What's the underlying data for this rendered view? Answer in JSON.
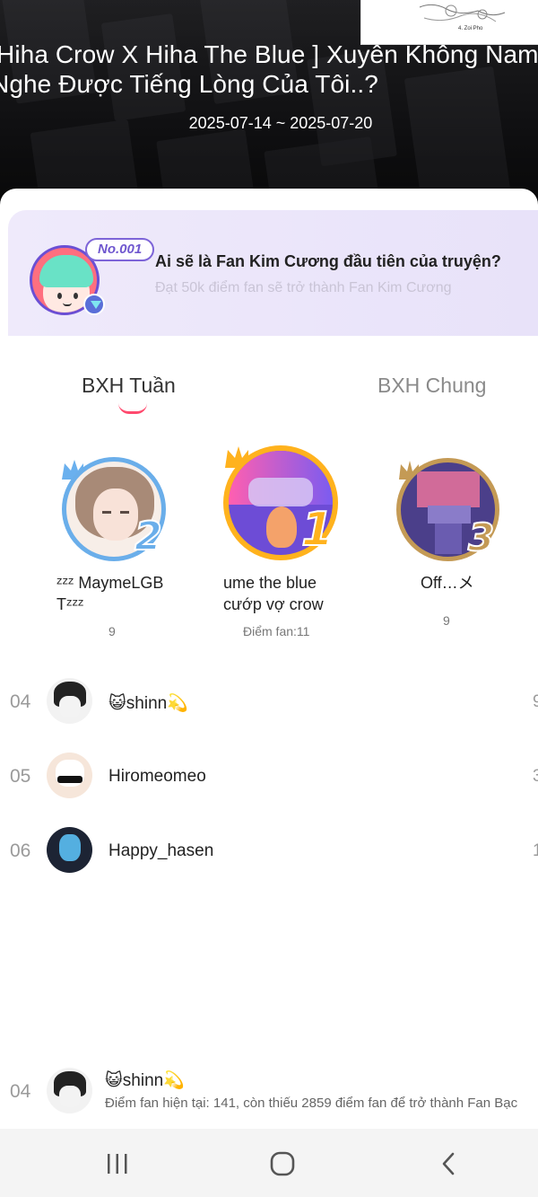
{
  "banner": {
    "title_line1": "Hiha Crow X Hiha The Blue ] Xuyên Không Nam",
    "title_line2": "Nghe Được Tiếng Lòng Của Tôi..?",
    "date_range": "2025-07-14 ~ 2025-07-20",
    "thumbnail_caption": "4. Zoi Pho"
  },
  "promo": {
    "badge": "No.001",
    "title": "Ai sẽ là Fan Kim Cương đầu tiên của truyện?",
    "subtitle": "Đạt 50k điểm fan sẽ trở thành Fan Kim Cương",
    "avatar_icon": "mascot-avatar",
    "badge_icon": "diamond-icon"
  },
  "tabs": [
    {
      "label": "BXH Tuần",
      "active": true
    },
    {
      "label": "BXH Chung",
      "active": false
    }
  ],
  "podium": [
    {
      "rank": "2",
      "name": "ᶻᶻᶻ MaymeLGB Tᶻᶻᶻ",
      "score": "9",
      "ring_color": "#6aaeea"
    },
    {
      "rank": "1",
      "name": "ume the blue cướp vợ crow",
      "score": "Điểm fan:11",
      "ring_color": "#ffb21d"
    },
    {
      "rank": "3",
      "name": "Off…メ",
      "score": "9",
      "ring_color": "#c49a55"
    }
  ],
  "list": [
    {
      "rank": "04",
      "name": "😺shinn💫",
      "score": "9"
    },
    {
      "rank": "05",
      "name": "Hiromeomeo",
      "score": "3"
    },
    {
      "rank": "06",
      "name": "Happy_hasen",
      "score": "1"
    }
  ],
  "me": {
    "rank": "04",
    "name": "😺shinn💫",
    "description": "Điểm fan hiện tại: 141, còn thiếu 2859 điểm fan để trở thành Fan Bạc"
  },
  "navbar": {
    "recents_icon": "recents-icon",
    "home_icon": "home-icon",
    "back_icon": "back-icon"
  }
}
